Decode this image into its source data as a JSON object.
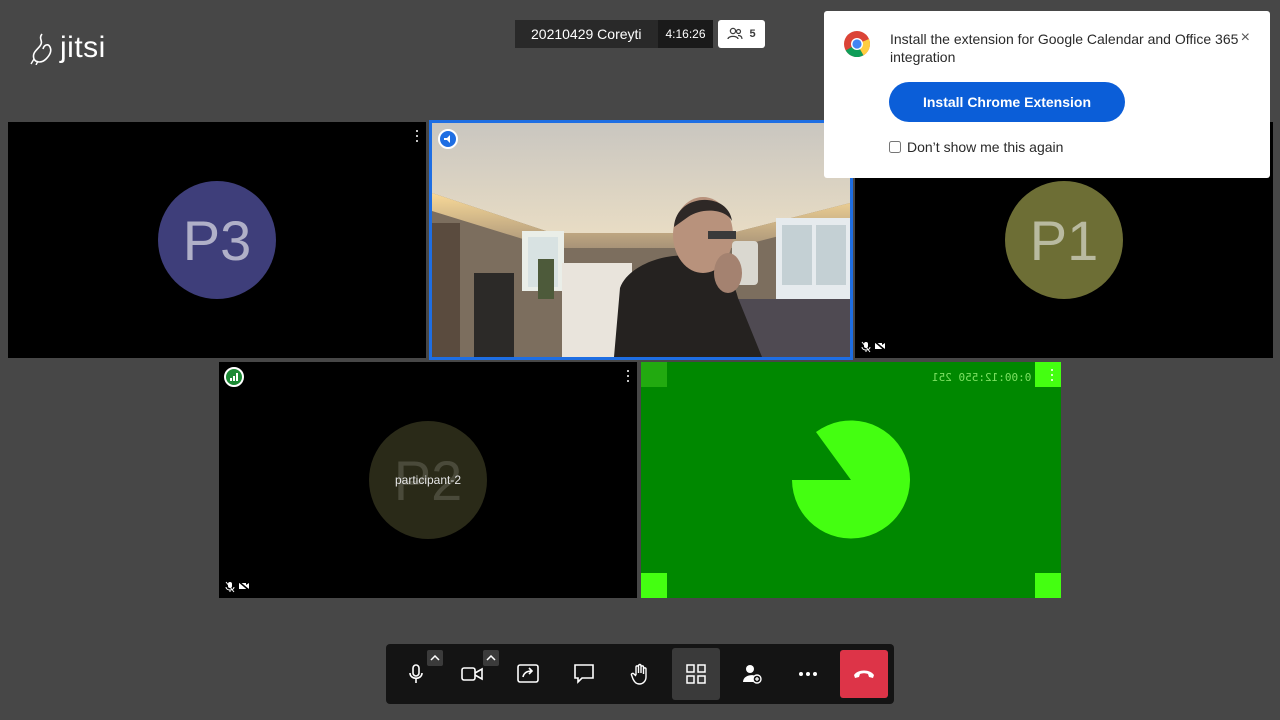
{
  "logo": {
    "text": "jitsi"
  },
  "header": {
    "subject": "20210429 Coreyti",
    "timer": "4:16:26",
    "participant_count": "5"
  },
  "tiles": {
    "p3": {
      "initials": "P3",
      "avatar_color": "#3e3e7a"
    },
    "camera": {
      "highlight_color": "#1e6ee3"
    },
    "p1": {
      "initials": "P1",
      "avatar_color": "#6d6e35"
    },
    "p2": {
      "initials": "P2",
      "display_name": "participant-2",
      "avatar_color": "#2a2a18"
    },
    "green": {
      "timer_text": "0:00:12:550 251",
      "background_color": "#008800",
      "pie_color": "#44ff11"
    }
  },
  "notification": {
    "message": "Install the extension for Google Calendar and Office 365 integration",
    "button_label": "Install Chrome Extension",
    "checkbox_label": "Don’t show me this again",
    "close_glyph": "×"
  },
  "toolbar": {
    "items": [
      "microphone-icon",
      "camera-icon",
      "share-screen-icon",
      "chat-icon",
      "raise-hand-icon",
      "tile-view-icon",
      "invite-icon",
      "more-icon",
      "hangup-icon"
    ],
    "hangup_color": "#dd3448"
  }
}
